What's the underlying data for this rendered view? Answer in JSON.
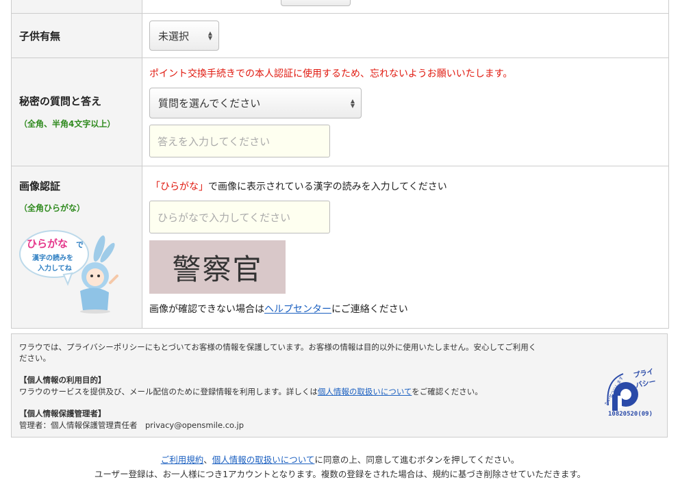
{
  "form": {
    "children": {
      "label": "子供有無",
      "select_value": "未選択"
    },
    "secret": {
      "label": "秘密の質問と答え",
      "sub": "（全角、半角4文字以上）",
      "notice": "ポイント交換手続きでの本人認証に使用するため、忘れないようお願いいたします。",
      "select_value": "質問を選んでください",
      "answer_placeholder": "答えを入力してください"
    },
    "captcha": {
      "label": "画像認証",
      "sub": "（全角ひらがな）",
      "mascot_line1": "ひらがな",
      "mascot_de": "で",
      "mascot_line2": "漢字の読みを",
      "mascot_line3": "入力してね",
      "instruction_open": "「",
      "instruction_hira": "ひらがな",
      "instruction_close": "」",
      "instruction_rest": "で画像に表示されている漢字の読みを入力してください",
      "input_placeholder": "ひらがなで入力してください",
      "image_text": "警察官",
      "help_before": "画像が確認できない場合は",
      "help_link": "ヘルプセンター",
      "help_after": "にご連絡ください"
    }
  },
  "privacy": {
    "intro": "ワラウでは、プライバシーポリシーにもとづいてお客様の情報を保護しています。お客様の情報は目的以外に使用いたしません。安心してご利用く",
    "intro2": "ださい。",
    "purpose_title": "【個人情報の利用目的】",
    "purpose_before": "ワラウのサービスを提供及び、メール配信のために登録情報を利用します。詳しくは",
    "purpose_link": "個人情報の取扱いについて",
    "purpose_after": "をご確認ください。",
    "manager_title": "【個人情報保護管理者】",
    "manager_text": "管理者：個人情報保護管理責任者　privacy@opensmile.co.jp",
    "pmark_top": "たいせつにします",
    "pmark_brand": "プライバシー",
    "pmark_number": "10820520(09)"
  },
  "footer": {
    "terms_link": "ご利用規約",
    "sep": "、",
    "privacy_link": "個人情報の取扱いについて",
    "agree_text": "に同意の上、同意して進むボタンを押してください。",
    "note": "ユーザー登録は、お一人様につき1アカウントとなります。複数の登録をされた場合は、規約に基づき削除させていただきます。"
  },
  "colors": {
    "accent_red": "#e0190f",
    "sub_green": "#2f8a1e",
    "link_blue": "#1a5fc0",
    "input_bg": "#fefff0",
    "captcha_bg": "#d9c8c9"
  }
}
